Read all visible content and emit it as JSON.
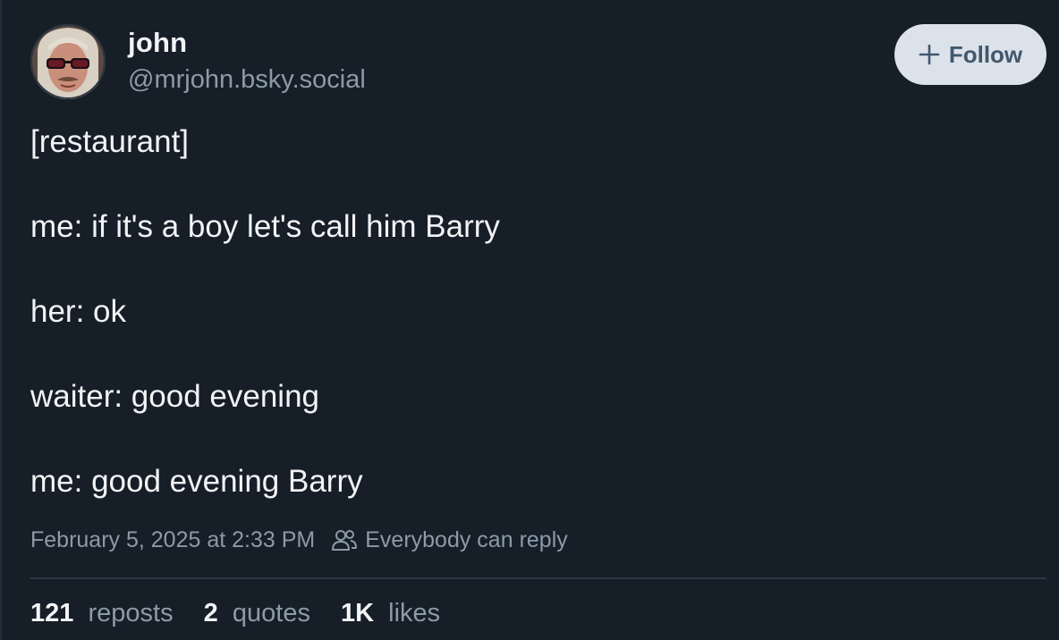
{
  "author": {
    "display_name": "john",
    "handle": "@mrjohn.bsky.social",
    "avatar_icon": "profile-photo"
  },
  "follow_button": {
    "icon": "plus-icon",
    "label": "Follow"
  },
  "post": {
    "lines": [
      "[restaurant]",
      "me: if it's a boy let's call him Barry",
      "her: ok",
      "waiter: good evening",
      "me: good evening Barry"
    ],
    "timestamp": "February 5, 2025 at 2:33 PM",
    "reply_setting_icon": "people-icon",
    "reply_setting": "Everybody can reply"
  },
  "stats": {
    "reposts_count": "121",
    "reposts_label": "reposts",
    "quotes_count": "2",
    "quotes_label": "quotes",
    "likes_count": "1K",
    "likes_label": "likes"
  },
  "colors": {
    "background": "#161e27",
    "text_primary": "#f1f3f5",
    "text_secondary": "#8d9aa9",
    "button_bg": "#dce2ea",
    "button_text": "#42576c"
  }
}
